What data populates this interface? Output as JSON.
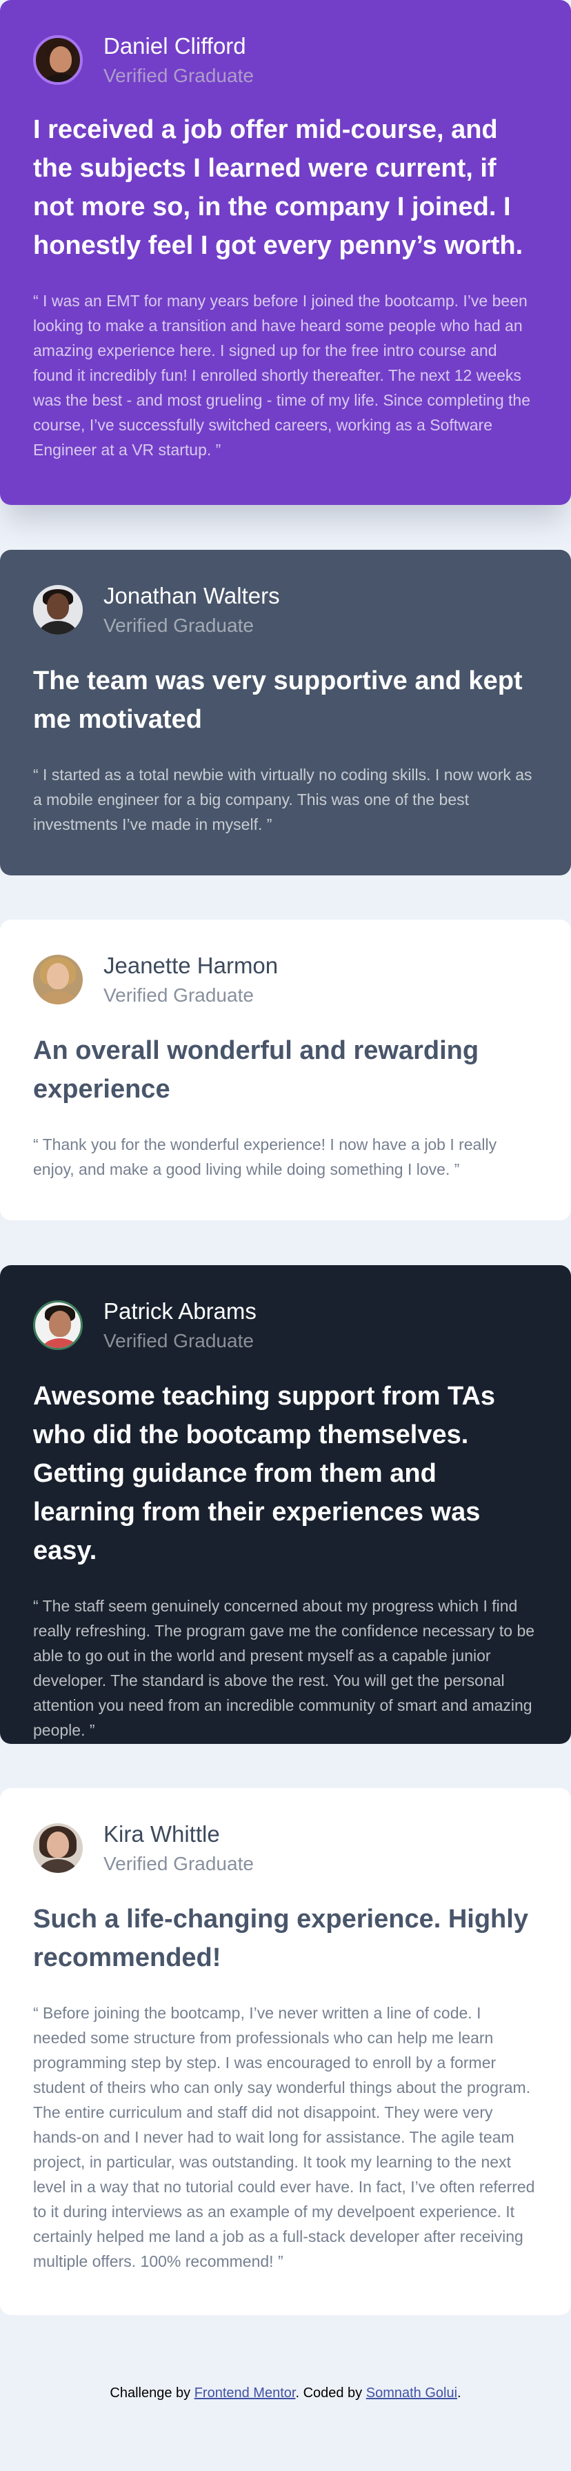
{
  "testimonials": [
    {
      "name": "Daniel Clifford",
      "role": "Verified Graduate",
      "headline": "I received a job offer mid-course, and the subjects I learned were current, if not more so, in the company I joined. I honestly feel I got every penny’s worth.",
      "quote": "“ I was an EMT for many years before I joined the bootcamp. I’ve been looking to make a transition and have heard some people who had an amazing experience here. I signed up for the free intro course and found it incredibly fun! I enrolled shortly thereafter. The next 12 weeks was the best - and most grueling - time of my life. Since completing the course, I’ve successfully switched careers, working as a Software Engineer at a VR startup. ”",
      "background": "#733fc8"
    },
    {
      "name": "Jonathan Walters",
      "role": "Verified Graduate",
      "headline": "The team was very supportive and kept me motivated",
      "quote": "“ I started as a total newbie with virtually no coding skills. I now work as a mobile engineer for a big company. This was one of the best investments I’ve made in myself. ”",
      "background": "#48556a"
    },
    {
      "name": "Jeanette Harmon",
      "role": "Verified Graduate",
      "headline": "An overall wonderful and rewarding experience",
      "quote": "“ Thank you for the wonderful experience! I now have a job I really enjoy, and make a good living while doing something I love. ”",
      "background": "#ffffff"
    },
    {
      "name": "Patrick Abrams",
      "role": "Verified Graduate",
      "headline": "Awesome teaching support from TAs who did the bootcamp themselves. Getting guidance from them and learning from their experiences was easy.",
      "quote": "“ The staff seem genuinely concerned about my progress which I find really refreshing. The program gave me the confidence necessary to be able to go out in the world and present myself as a capable junior developer. The standard is above the rest. You will get the personal attention you need from an incredible community of smart and amazing people. ”",
      "background": "#19212e"
    },
    {
      "name": "Kira Whittle",
      "role": "Verified Graduate",
      "headline": "Such a life-changing experience. Highly recommended!",
      "quote": "“ Before joining the bootcamp, I’ve never written a line of code. I needed some structure from professionals who can help me learn programming step by step. I was encouraged to enroll by a former student of theirs who can only say wonderful things about the program. The entire curriculum and staff did not disappoint. They were very hands-on and I never had to wait long for assistance. The agile team project, in particular, was outstanding. It took my learning to the next level in a way that no tutorial could ever have. In fact, I’ve often referred to it during interviews as an example of my develpoent experience. It certainly helped me land a job as a full-stack developer after receiving multiple offers. 100% recommend! ”",
      "background": "#ffffff"
    }
  ],
  "footer": {
    "prefix": "Challenge by ",
    "challenge_link": "Frontend Mentor",
    "middle": ". Coded by ",
    "author_link": "Somnath Golui",
    "suffix": "."
  },
  "colors": {
    "page_background": "#edf1f8",
    "link": "#3e52a3"
  }
}
